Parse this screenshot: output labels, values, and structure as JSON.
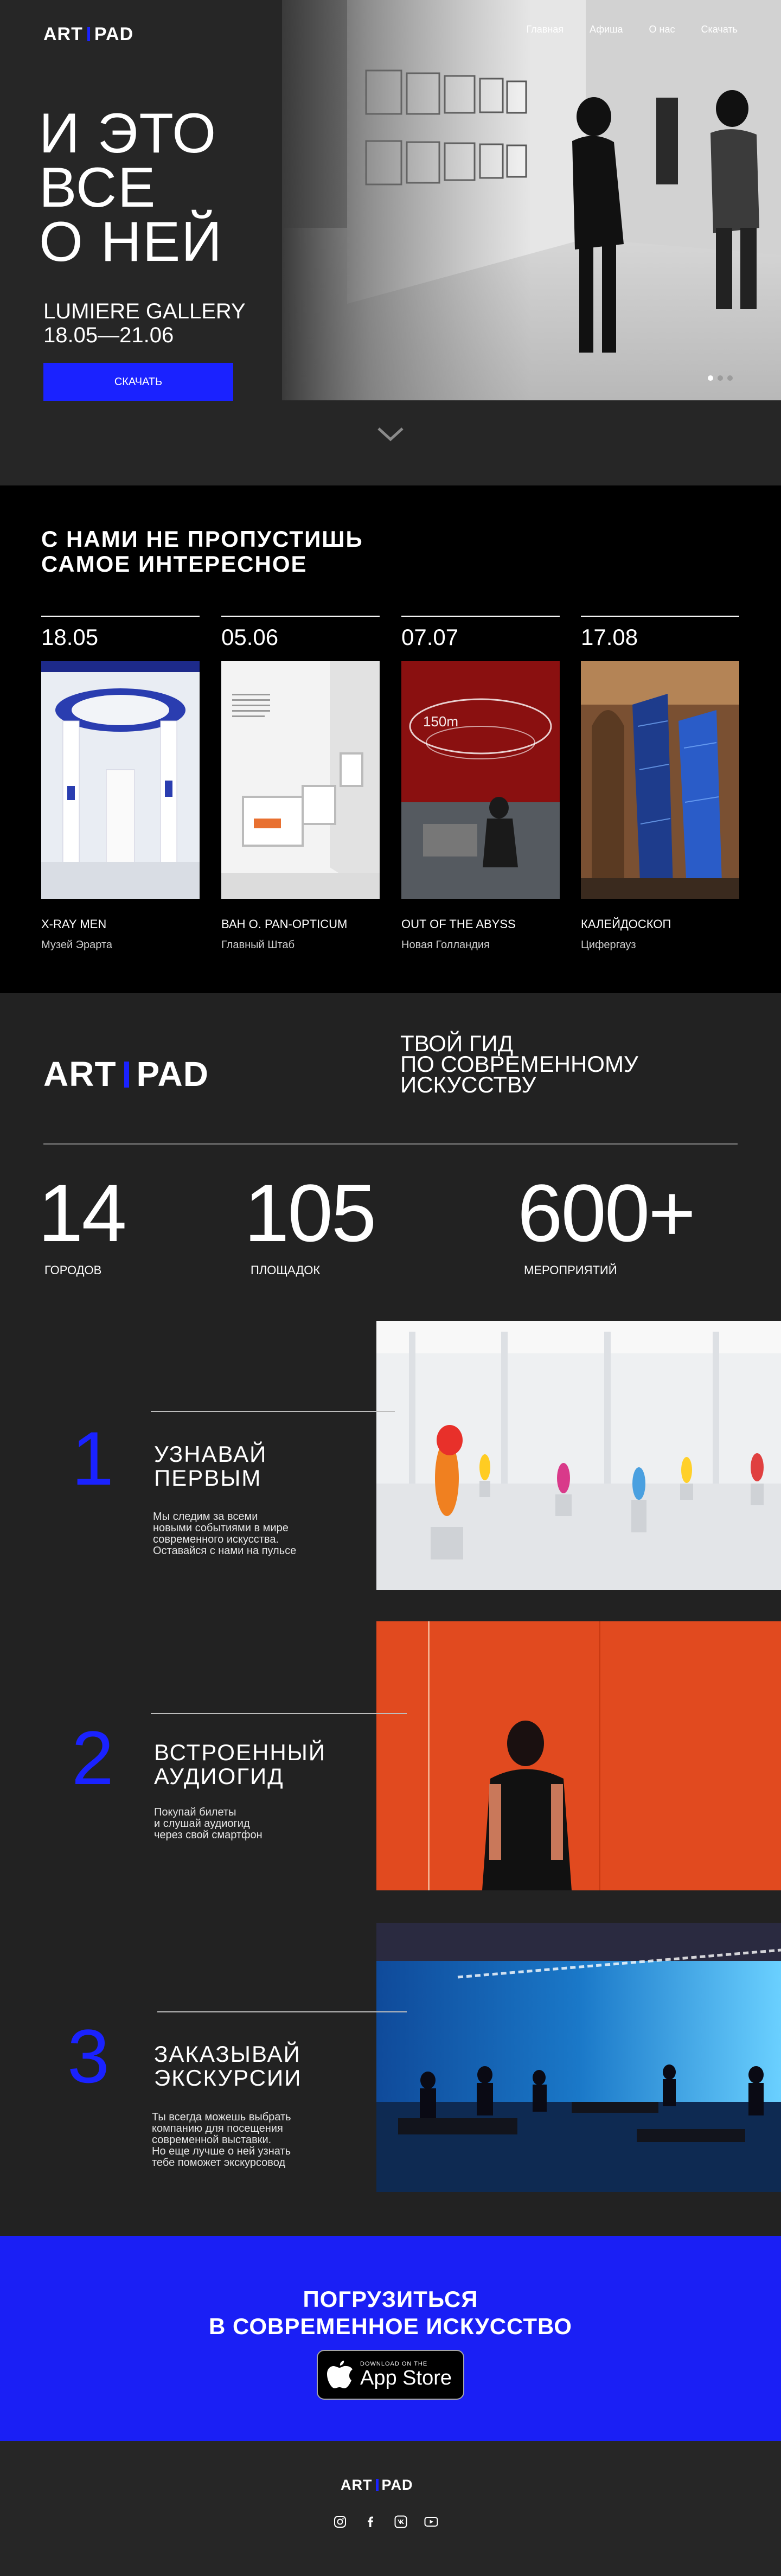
{
  "brand": {
    "left": "ART",
    "right": "PAD",
    "accent": "#1a22ff"
  },
  "nav": {
    "items": [
      "Главная",
      "Афиша",
      "О нас",
      "Скачать"
    ]
  },
  "hero": {
    "title_lines": [
      "И ЭТО",
      "ВСЕ",
      "О НЕЙ"
    ],
    "gallery_name": "LUMIERE GALLERY",
    "dates": "18.05—21.06",
    "download_label": "СКАЧАТЬ",
    "slider": {
      "count": 3,
      "active": 1
    }
  },
  "events": {
    "heading_lines": [
      "С НАМИ НЕ ПРОПУСТИШЬ",
      "САМОЕ ИНТЕРЕСНОЕ"
    ],
    "items": [
      {
        "date": "18.05",
        "name": "X-RAY MEN",
        "place": "Музей Эрарта"
      },
      {
        "date": "05.06",
        "name": "ВАН О. PAN-OPTICUM",
        "place": "Главный Штаб"
      },
      {
        "date": "07.07",
        "name": "OUT OF THE ABYSS",
        "place": "Новая Голландия"
      },
      {
        "date": "17.08",
        "name": "КАЛЕЙДОСКОП",
        "place": "Цифергауз"
      }
    ]
  },
  "guide": {
    "tagline_lines": [
      "ТВОЙ ГИД",
      "ПО СОВРЕМЕННОМУ",
      "ИСКУССТВУ"
    ],
    "stats": [
      {
        "value": "14",
        "label": "ГОРОДОВ"
      },
      {
        "value": "105",
        "label": "ПЛОЩАДОК"
      },
      {
        "value": "600+",
        "label": "МЕРОПРИЯТИЙ"
      }
    ],
    "features": [
      {
        "num": "1",
        "title_lines": [
          "УЗНАВАЙ",
          "ПЕРВЫМ"
        ],
        "text_lines": [
          "Мы следим за всеми",
          "новыми событиями в мире",
          "современного искусства.",
          "Оставайся с нами на пульсе"
        ]
      },
      {
        "num": "2",
        "title_lines": [
          "ВСТРОЕННЫЙ",
          "АУДИОГИД"
        ],
        "text_lines": [
          "Покупай билеты",
          "и  слушай аудиогид",
          "через свой смартфон"
        ]
      },
      {
        "num": "3",
        "title_lines": [
          "ЗАКАЗЫВАЙ",
          "ЭКСКУРСИИ"
        ],
        "text_lines": [
          "Ты всегда можешь выбрать",
          "компанию для посещения",
          "современной выставки.",
          "Но еще лучше о ней узнать",
          "тебе поможет экскурсовод"
        ]
      }
    ]
  },
  "cta": {
    "title_lines": [
      "ПОГРУЗИТЬСЯ",
      "В СОВРЕМЕННОЕ ИСКУССТВО"
    ],
    "store_small": "DOWNLOAD ON THE",
    "store_big": "App Store"
  },
  "footer": {
    "social_icons": [
      "instagram-icon",
      "facebook-icon",
      "vk-icon",
      "youtube-icon"
    ]
  }
}
